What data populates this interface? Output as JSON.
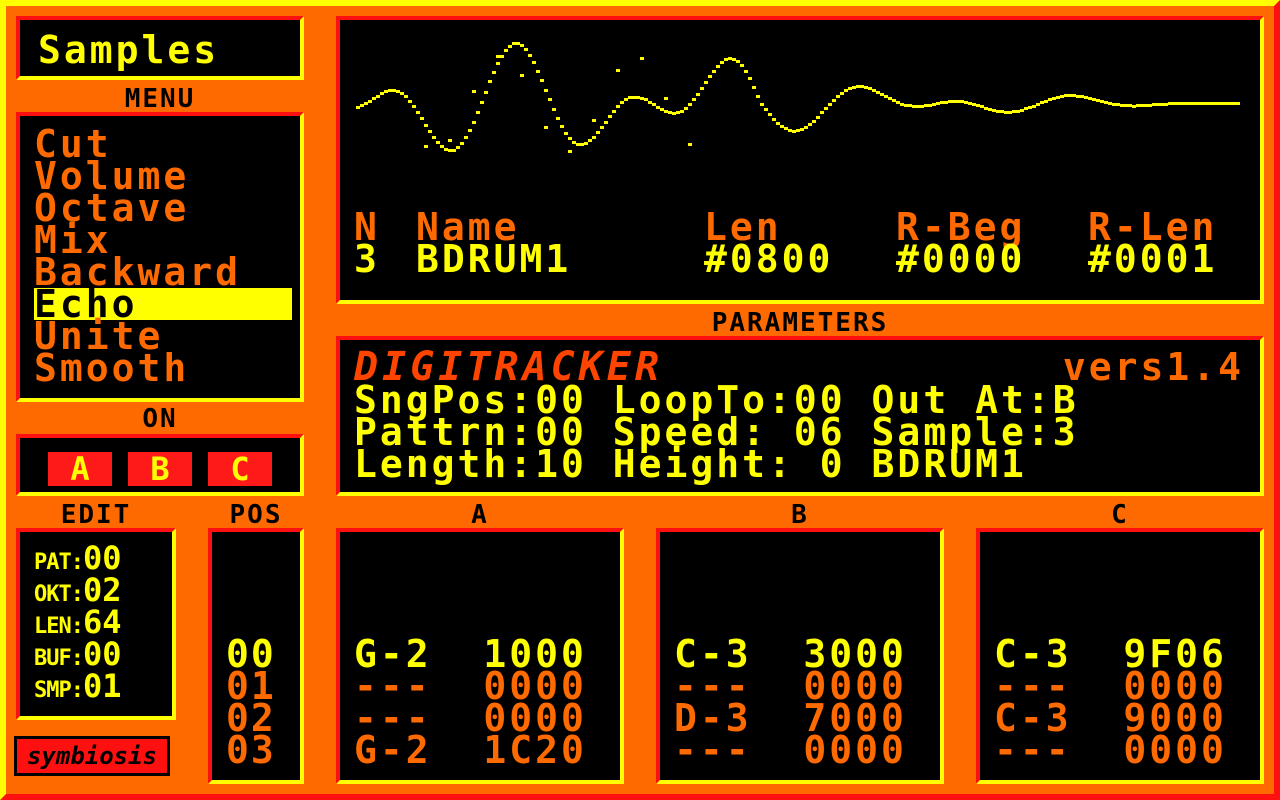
{
  "title": "Samples",
  "labels": {
    "menu": "MENU",
    "on": "ON",
    "edit": "EDIT",
    "pos": "POS",
    "parameters": "PARAMETERS",
    "channel_a": "A",
    "channel_b": "B",
    "channel_c": "C"
  },
  "menu": {
    "items": [
      "Cut",
      "Volume",
      "Octave",
      "Mix",
      "Backward",
      "Echo",
      "Unite",
      "Smooth"
    ],
    "selected": "Echo"
  },
  "on_channels": [
    "A",
    "B",
    "C"
  ],
  "edit": {
    "rows": [
      {
        "key": "PAT:",
        "value": "00"
      },
      {
        "key": "OKT:",
        "value": "02"
      },
      {
        "key": "LEN:",
        "value": "64"
      },
      {
        "key": "BUF:",
        "value": "00"
      },
      {
        "key": "SMP:",
        "value": "01"
      }
    ]
  },
  "pos": [
    "00",
    "01",
    "02",
    "03"
  ],
  "sample": {
    "headers": {
      "n": "N",
      "name": "Name",
      "len": "Len",
      "rbeg": "R-Beg",
      "rlen": "R-Len"
    },
    "values": {
      "n": "3",
      "name": "BDRUM1",
      "len": "#0800",
      "rbeg": "#0000",
      "rlen": "#0001"
    }
  },
  "parameters": {
    "logo": "DIGITRACKER",
    "version": "vers1.4",
    "line1": "SngPos:00 LoopTo:00 Out At:B",
    "line2": "Pattrn:00 Speed: 06 Sample:3",
    "line3": "Length:10 Height: 0 BDRUM1"
  },
  "channels": {
    "a": [
      {
        "note": "G-2",
        "cmd": "1000"
      },
      {
        "note": "---",
        "cmd": "0000"
      },
      {
        "note": "---",
        "cmd": "0000"
      },
      {
        "note": "G-2",
        "cmd": "1C20"
      }
    ],
    "b": [
      {
        "note": "C-3",
        "cmd": "3000"
      },
      {
        "note": "---",
        "cmd": "0000"
      },
      {
        "note": "D-3",
        "cmd": "7000"
      },
      {
        "note": "---",
        "cmd": "0000"
      }
    ],
    "c": [
      {
        "note": "C-3",
        "cmd": "9F06"
      },
      {
        "note": "---",
        "cmd": "0000"
      },
      {
        "note": "C-3",
        "cmd": "9000"
      },
      {
        "note": "---",
        "cmd": "0000"
      }
    ]
  },
  "footer_logo": "symbiosis",
  "colors": {
    "background": "#ff6a00",
    "highlight": "#ffff00",
    "accent": "#ff1010",
    "panel": "#000000"
  }
}
